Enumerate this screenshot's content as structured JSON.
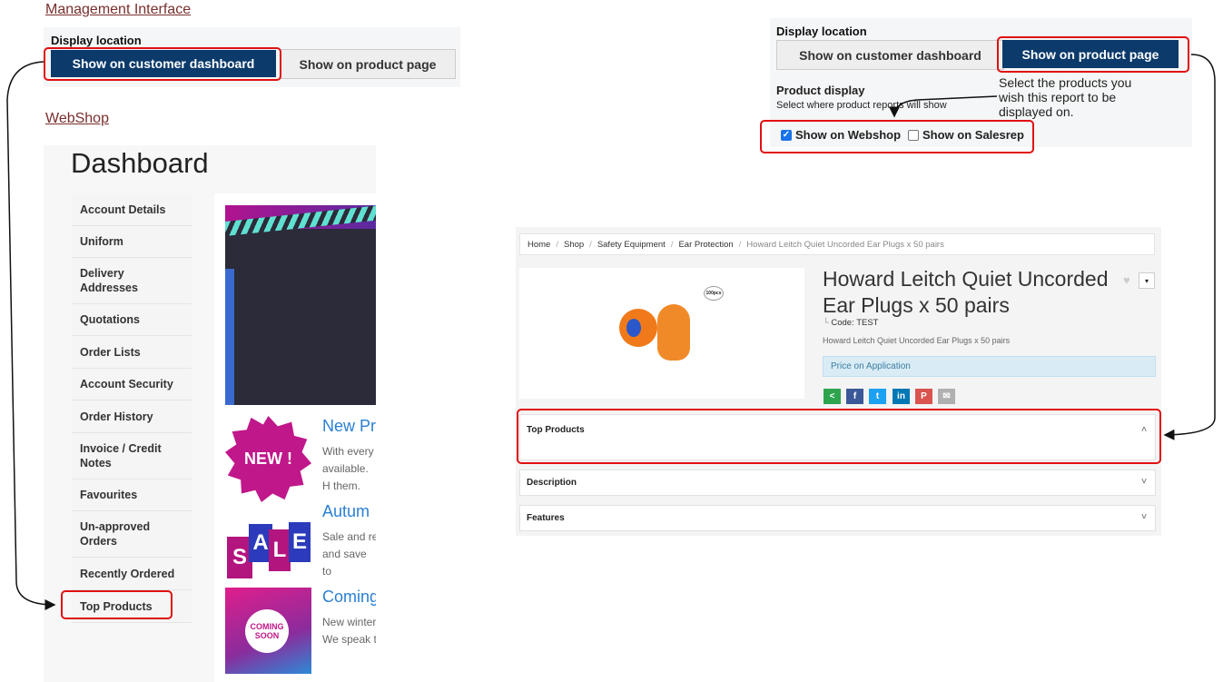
{
  "management": {
    "heading": "Management Interface",
    "display_location_label": "Display location",
    "btn_dashboard": "Show on customer dashboard",
    "btn_product": "Show on product page"
  },
  "webshop": {
    "heading": "WebShop",
    "dashboard_title": "Dashboard",
    "menu": [
      "Account Details",
      "Uniform",
      "Delivery Addresses",
      "Quotations",
      "Order Lists",
      "Account Security",
      "Order History",
      "Invoice / Credit Notes",
      "Favourites",
      "Un-approved Orders",
      "Recently Ordered",
      "Top Products"
    ],
    "news": [
      {
        "title": "New Pr",
        "text": "With every available. H them.",
        "badge": "NEW !"
      },
      {
        "title": "Autum",
        "text": "Sale and re and save to",
        "badge": "SALE"
      },
      {
        "title": "Coming",
        "text": "New winter We speak t",
        "badge": "COMING SOON"
      }
    ]
  },
  "product_settings": {
    "display_location_label": "Display location",
    "btn_dashboard": "Show on customer dashboard",
    "btn_product": "Show on product page",
    "product_display_label": "Product display",
    "product_display_help": "Select where product reports will show",
    "note": "Select the products you wish this report to be displayed on.",
    "show_on_webshop": "Show on Webshop",
    "show_on_salesrep": "Show on Salesrep",
    "webshop_checked": true,
    "salesrep_checked": false
  },
  "product_page": {
    "breadcrumbs": [
      "Home",
      "Shop",
      "Safety Equipment",
      "Ear Protection",
      "Howard Leitch Quiet Uncorded Ear Plugs x 50 pairs"
    ],
    "title": "Howard Leitch Quiet Uncorded Ear Plugs x 50 pairs",
    "code": "Code: TEST",
    "subtitle": "Howard Leitch Quiet Uncorded Ear Plugs x 50 pairs",
    "price": "Price on Application",
    "image_badge": "100pcs",
    "sections": [
      "Top Products",
      "Description",
      "Features"
    ],
    "share_icons": [
      {
        "name": "share-icon",
        "glyph": "<",
        "color": "#2ea44f"
      },
      {
        "name": "facebook-icon",
        "glyph": "f",
        "color": "#3b5998"
      },
      {
        "name": "twitter-icon",
        "glyph": "t",
        "color": "#1da1f2"
      },
      {
        "name": "linkedin-icon",
        "glyph": "in",
        "color": "#0077b5"
      },
      {
        "name": "pinterest-icon",
        "glyph": "P",
        "color": "#d9534f"
      },
      {
        "name": "email-icon",
        "glyph": "✉",
        "color": "#b0b0b0"
      }
    ]
  },
  "colors": {
    "accent": "#0b3a6b",
    "highlight": "#e01010"
  }
}
